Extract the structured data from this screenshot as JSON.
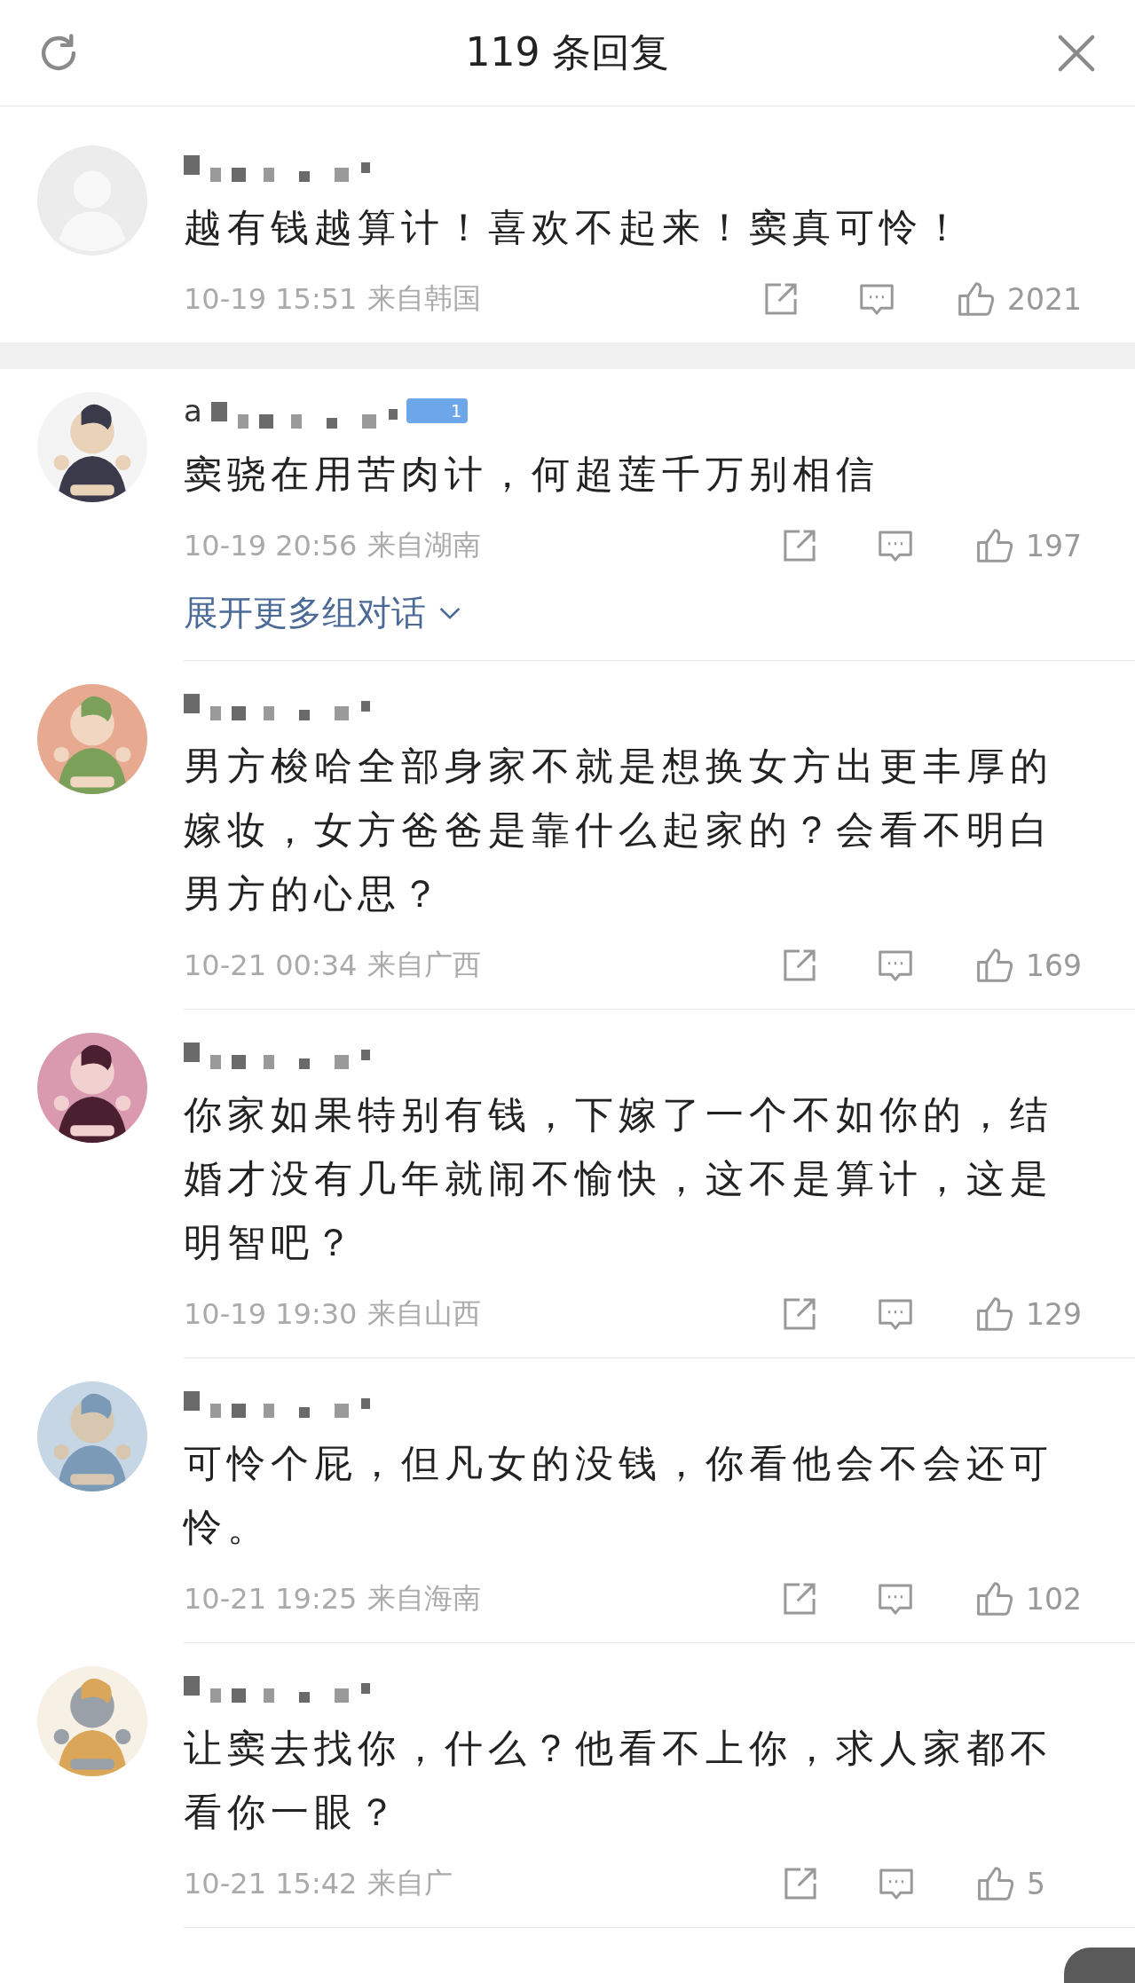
{
  "header": {
    "title": "119 条回复"
  },
  "comments": [
    {
      "kind": "root",
      "avatar": {
        "kind": "default"
      },
      "text": "越有钱越算计！喜欢不起来！窦真可怜！",
      "time": "10-19 15:51",
      "location": "来自韩国",
      "likes": "2021"
    },
    {
      "kind": "reply",
      "username": "a",
      "badge": "1",
      "text": "窦骁在用苦肉计，何超莲千万别相信",
      "time": "10-19 20:56",
      "location": "来自湖南",
      "likes": "197",
      "expand": "展开更多组对话"
    },
    {
      "kind": "reply",
      "text": "男方梭哈全部身家不就是想换女方出更丰厚的嫁妆，女方爸爸是靠什么起家的？会看不明白男方的心思？",
      "time": "10-21 00:34",
      "location": "来自广西",
      "likes": "169"
    },
    {
      "kind": "reply",
      "text": "你家如果特别有钱，下嫁了一个不如你的，结婚才没有几年就闹不愉快，这不是算计，这是明智吧？",
      "time": "10-19 19:30",
      "location": "来自山西",
      "likes": "129"
    },
    {
      "kind": "reply",
      "text": "可怜个屁，但凡女的没钱，你看他会不会还可怜。",
      "time": "10-21 19:25",
      "location": "来自海南",
      "likes": "102"
    },
    {
      "kind": "reply",
      "text": "让窦去找你，什么？他看不上你，求人家都不看你一眼？",
      "time": "10-21 15:42",
      "location": "来自广",
      "likes": "5"
    }
  ]
}
